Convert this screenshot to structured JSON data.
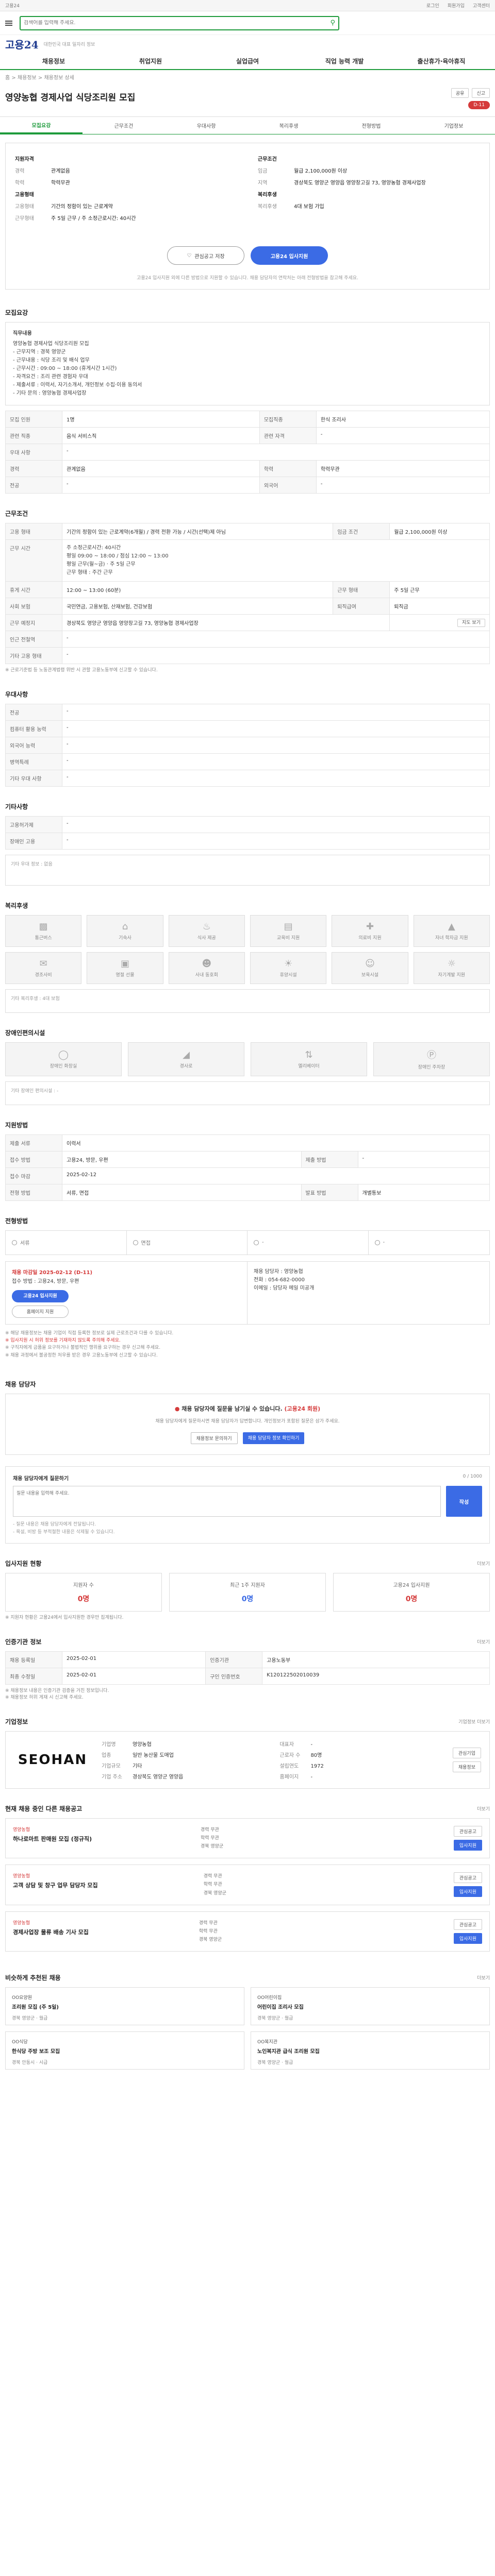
{
  "topbar": {
    "left": "고용24",
    "right1": "로그인",
    "right2": "회원가입",
    "right3": "고객센터"
  },
  "header": {
    "search_placeholder": "검색어를 입력해 주세요.",
    "go_label": "검색"
  },
  "logo": {
    "title": "고용24",
    "tag": "대한민국 대표 일자리 정보"
  },
  "gnb": [
    "채용정보",
    "취업지원",
    "실업급여",
    "직업 능력 개발",
    "출산휴가·육아휴직"
  ],
  "breadcrumb": "홈 > 채용정보 > 채용정보 상세",
  "job": {
    "title": "영양농협 경제사업 식당조리원 모집",
    "share": "공유",
    "report": "신고",
    "ddays": "D-11",
    "tabs": [
      "모집요강",
      "근무조건",
      "우대사항",
      "복리후생",
      "전형방법",
      "기업정보"
    ],
    "summary": {
      "left_head": "지원자격",
      "left_sub": "모집요강",
      "left": [
        {
          "k": "경력",
          "v": "관계없음"
        },
        {
          "k": "학력",
          "v": "학력무관"
        }
      ],
      "left_sub2": "고용형태",
      "left2": [
        {
          "k": "고용형태",
          "v": "기간의 정함이 있는 근로계약"
        },
        {
          "k": "근무형태",
          "v": "주 5일 근무 / 주 소정근로시간: 40시간"
        }
      ],
      "right_head": "근무조건",
      "right": [
        {
          "k": "임금",
          "v": "월급 2,100,000원 이상"
        },
        {
          "k": "지역",
          "v": "경상북도 영양군 영양읍 영양창고길 73, 영양농협 경제사업장"
        }
      ],
      "right_sub": "복리후생",
      "right2": [
        {
          "k": "복리후생",
          "v": "4대 보험 가입"
        }
      ]
    },
    "btn_scrap": "관심공고 저장",
    "btn_apply": "고용24 입사지원",
    "apply_note": "고용24 입사지원 외에 다른 방법으로 지원할 수 있습니다. 채용 담당자의 연락처는 아래 전형방법을 참고해 주세요."
  },
  "recruit": {
    "title": "모집요강",
    "duty_label": "직무내용",
    "duty_lines": [
      "영양농협 경제사업 식당조리원 모집",
      "- 근무지역 : 경북 영양군",
      "- 근무내용 : 식당 조리 및 배식 업무",
      "- 근무시간 : 09:00 ~ 18:00 (휴게시간 1시간)",
      "- 자격요건 : 조리 관련 경험자 우대",
      "- 제출서류 : 이력서, 자기소개서, 개인정보 수집·이용 동의서",
      "- 기타 문의 : 영양농협 경제사업장"
    ],
    "rows": [
      [
        {
          "k": "모집 인원",
          "v": "1명"
        },
        {
          "k": "모집직종",
          "v": "한식 조리사"
        }
      ],
      [
        {
          "k": "관련 직종",
          "v": "음식 서비스직"
        },
        {
          "k": "관련 자격",
          "v": "-"
        }
      ],
      [
        {
          "k": "우대 사항",
          "v": "-"
        },
        {
          "k": "",
          "v": ""
        }
      ],
      [
        {
          "k": "경력",
          "v": "관계없음"
        },
        {
          "k": "학력",
          "v": "학력무관"
        }
      ],
      [
        {
          "k": "전공",
          "v": "-"
        },
        {
          "k": "외국어",
          "v": "-"
        }
      ]
    ]
  },
  "conditions": {
    "title": "근무조건",
    "rows": [
      {
        "k": "고용 형태",
        "v": "기간의 정함이 있는 근로계약(6개월) / 경력 전환 가능 / 시간(선택)제 아님",
        "k2": "임금 조건",
        "v2": "월급 2,100,000원 이상"
      },
      {
        "k": "근무 예정지",
        "v": "경상북도 영양군 영양읍 영양창고길 73",
        "k2": "",
        "v2": ""
      }
    ],
    "time_label": "근무 시간",
    "time_lines": [
      "주 소정근로시간: 40시간",
      "평일 09:00 ~ 18:00 / 점심 12:00 ~ 13:00",
      "평일 근무(월~금) · 주 5일 근무",
      "근무 형태 : 주간 근무"
    ],
    "rows2": [
      {
        "k": "휴게 시간",
        "v": "12:00 ~ 13:00 (60분)",
        "k2": "근무 형태",
        "v2": "주 5일 근무"
      },
      {
        "k": "사회 보험",
        "v": "국민연금, 고용보험, 산재보험, 건강보험",
        "k2": "퇴직급여",
        "v2": "퇴직금"
      },
      {
        "k": "근무 예정지",
        "v": "경상북도 영양군 영양읍 영양창고길 73, 영양농협 경제사업장",
        "k2": "",
        "v2": ""
      },
      {
        "k": "인근 전철역",
        "v": "-",
        "k2": "",
        "v2": ""
      },
      {
        "k": "기타 고용 형태",
        "v": "-",
        "k2": "",
        "v2": ""
      }
    ],
    "map_btn": "지도 보기",
    "note": "※ 근로기준법 등 노동관계법령 위반 시 관할 고용노동부에 신고할 수 있습니다."
  },
  "preference": {
    "title": "우대사항",
    "rows": [
      {
        "k": "전공",
        "v": "-"
      },
      {
        "k": "컴퓨터 활용 능력",
        "v": "-"
      },
      {
        "k": "외국어 능력",
        "v": "-"
      },
      {
        "k": "병역특례",
        "v": "-"
      },
      {
        "k": "기타 우대 사항",
        "v": "-"
      }
    ]
  },
  "other": {
    "title": "기타사항",
    "rows": [
      {
        "k": "고용허가제",
        "v": "-"
      },
      {
        "k": "장애인 고용",
        "v": "-"
      }
    ],
    "extra_label": "기타 우대 정보",
    "extra_value": "없음"
  },
  "welfare": {
    "title": "복리후생",
    "tiles": [
      "통근버스",
      "기숙사",
      "식사 제공",
      "교육비 지원",
      "의료비 지원",
      "자녀 학자금 지원",
      "경조사비",
      "명절 선물",
      "사내 동호회",
      "휴양시설",
      "보육시설",
      "자기계발 지원"
    ],
    "note_label": "기타 복리후생",
    "note_value": "4대 보험"
  },
  "disabled": {
    "title": "장애인편의시설",
    "tiles": [
      "장애인 화장실",
      "경사로",
      "엘리베이터",
      "장애인 주차장"
    ],
    "note_label": "기타 장애인 편의시설",
    "note_value": "-"
  },
  "qualification": {
    "title": "지원방법",
    "rows": [
      {
        "k": "제출 서류",
        "v": "이력서",
        "k2": "",
        "v2": ""
      },
      {
        "k": "접수 방법",
        "v": "고용24, 방문, 우편",
        "k2": "제출 방법",
        "v2": "-"
      },
      {
        "k": "접수 마감",
        "v": "2025-02-12",
        "k2": "",
        "v2": ""
      },
      {
        "k": "전형 방법",
        "v": "서류, 면접",
        "k2": "발표 방법",
        "v2": "개별통보"
      }
    ]
  },
  "process": {
    "title": "전형방법",
    "steps": [
      "서류",
      "면접",
      "-",
      "-"
    ],
    "deadline": "채용 마감일 2025-02-12 (D-11)",
    "apply_methods": "접수 방법 : 고용24, 방문, 우편",
    "contact_lines": [
      "채용 담당자 : 영양농협",
      "전화 : 054-682-0000",
      "이메일 : 담당자 메일 미공개"
    ],
    "btn_apply": "고용24 입사지원",
    "btn_home": "홈페이지 지원",
    "warn": [
      "※ 해당 채용정보는 채용 기업이 직접 등록한 정보로 실제 근로조건과 다를 수 있습니다.",
      "※ 입사지원 시 허위 정보를 기재하지 않도록 주의해 주세요.",
      "※ 구직자에게 금품을 요구하거나 불법적인 행위를 요구하는 경우 신고해 주세요.",
      "※ 채용 과정에서 불공정한 처우를 받은 경우 고용노동부에 신고할 수 있습니다."
    ]
  },
  "qa": {
    "title": "채용 담당자",
    "q1a": "채용 담당자에 질문을 남기실 수 있습니다.",
    "q1b": "(고용24 회원)",
    "q2": "채용 담당자에게 질문하시면 채용 담당자가 답변합니다. 개인정보가 포함된 질문은 삼가 주세요.",
    "btn_a": "채용정보 문의하기",
    "btn_b": "채용 담당자 정보 확인하기",
    "inquiry_head": "채용 담당자에게 질문하기",
    "inquiry_more": "0 / 1000",
    "inquiry_placeholder": "질문 내용을 입력해 주세요.",
    "inquiry_send": "작성",
    "inquiry_notes": [
      "- 질문 내용은 채용 담당자에게 전달됩니다.",
      "- 욕설, 비방 등 부적절한 내용은 삭제될 수 있습니다."
    ]
  },
  "stats": {
    "title": "입사지원 현황",
    "more": "더보기",
    "items": [
      {
        "l": "지원자 수",
        "n": "0명"
      },
      {
        "l": "최근 1주 지원자",
        "n": "0명"
      },
      {
        "l": "고용24 입사지원",
        "n": "0명"
      }
    ],
    "note": "※ 지원자 현황은 고용24에서 입사지원한 경우만 집계됩니다."
  },
  "info": {
    "title": "인증기관 정보",
    "more": "더보기",
    "rows": [
      {
        "k": "채용 등록일",
        "v": "2025-02-01",
        "k2": "인증기관",
        "v2": "고용노동부"
      },
      {
        "k": "최종 수정일",
        "v": "2025-02-01",
        "k2": "구인 인증번호",
        "v2": "K120122502010039"
      }
    ],
    "notes": [
      "※ 채용정보 내용은 인증기관 검증을 거친 정보입니다.",
      "※ 채용정보 허위 게재 시 신고해 주세요."
    ]
  },
  "company": {
    "title": "기업정보",
    "more": "기업정보 더보기",
    "logo_text": "SEOHAN",
    "info": [
      {
        "k": "기업명",
        "v": "영양농협"
      },
      {
        "k": "대표자",
        "v": "-"
      },
      {
        "k": "업종",
        "v": "일반 농산물 도매업"
      },
      {
        "k": "근로자 수",
        "v": "80명"
      },
      {
        "k": "기업규모",
        "v": "기타"
      },
      {
        "k": "설립연도",
        "v": "1972"
      },
      {
        "k": "기업 주소",
        "v": "경상북도 영양군 영양읍"
      },
      {
        "k": "홈페이지",
        "v": "-"
      }
    ],
    "btn1": "관심기업",
    "btn2": "채용정보"
  },
  "other_jobs": {
    "title": "현재 채용 중인 다른 채용공고",
    "more": "더보기",
    "items": [
      {
        "co": "영양농협",
        "tt": "하나로마트 판매원 모집 (정규직)",
        "m1": "경력 무관",
        "m2": "학력 무관",
        "m3": "경북 영양군",
        "b1": "관심공고",
        "b2": "입사지원"
      },
      {
        "co": "영양농협",
        "tt": "고객 상담 및 창구 업무 담당자 모집",
        "m1": "경력 무관",
        "m2": "학력 무관",
        "m3": "경북 영양군",
        "b1": "관심공고",
        "b2": "입사지원"
      },
      {
        "co": "영양농협",
        "tt": "경제사업장 물류 배송 기사 모집",
        "m1": "경력 무관",
        "m2": "학력 무관",
        "m3": "경북 영양군",
        "b1": "관심공고",
        "b2": "입사지원"
      }
    ]
  },
  "recommend": {
    "title": "비슷하게 추천된 채용",
    "more": "더보기",
    "items": [
      {
        "co": "OO요양원",
        "tt": "조리원 모집 (주 5일)",
        "mt": "경북 영양군 · 월급"
      },
      {
        "co": "OO어린이집",
        "tt": "어린이집 조리사 모집",
        "mt": "경북 영양군 · 월급"
      },
      {
        "co": "OO식당",
        "tt": "한식당 주방 보조 모집",
        "mt": "경북 안동시 · 시급"
      },
      {
        "co": "OO복지관",
        "tt": "노인복지관 급식 조리원 모집",
        "mt": "경북 영양군 · 월급"
      }
    ]
  }
}
